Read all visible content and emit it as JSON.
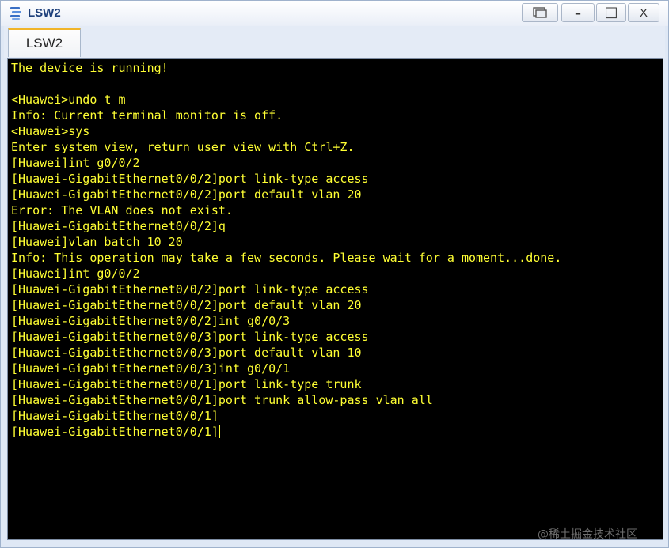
{
  "window": {
    "title": "LSW2",
    "controls": {
      "minimize": "–",
      "maximize": "□",
      "close": "X"
    }
  },
  "tabs": [
    {
      "label": "LSW2",
      "active": true
    }
  ],
  "terminal": {
    "text_color": "#ffff33",
    "background": "#000000",
    "lines": [
      "The device is running!",
      "",
      "<Huawei>undo t m",
      "Info: Current terminal monitor is off.",
      "<Huawei>sys",
      "Enter system view, return user view with Ctrl+Z.",
      "[Huawei]int g0/0/2",
      "[Huawei-GigabitEthernet0/0/2]port link-type access",
      "[Huawei-GigabitEthernet0/0/2]port default vlan 20",
      "Error: The VLAN does not exist.",
      "[Huawei-GigabitEthernet0/0/2]q",
      "[Huawei]vlan batch 10 20",
      "Info: This operation may take a few seconds. Please wait for a moment...done.",
      "[Huawei]int g0/0/2",
      "[Huawei-GigabitEthernet0/0/2]port link-type access",
      "[Huawei-GigabitEthernet0/0/2]port default vlan 20",
      "[Huawei-GigabitEthernet0/0/2]int g0/0/3",
      "[Huawei-GigabitEthernet0/0/3]port link-type access",
      "[Huawei-GigabitEthernet0/0/3]port default vlan 10",
      "[Huawei-GigabitEthernet0/0/3]int g0/0/1",
      "[Huawei-GigabitEthernet0/0/1]port link-type trunk",
      "[Huawei-GigabitEthernet0/0/1]port trunk allow-pass vlan all",
      "[Huawei-GigabitEthernet0/0/1]",
      "[Huawei-GigabitEthernet0/0/1]"
    ]
  },
  "watermark": "@稀土掘金技术社区"
}
